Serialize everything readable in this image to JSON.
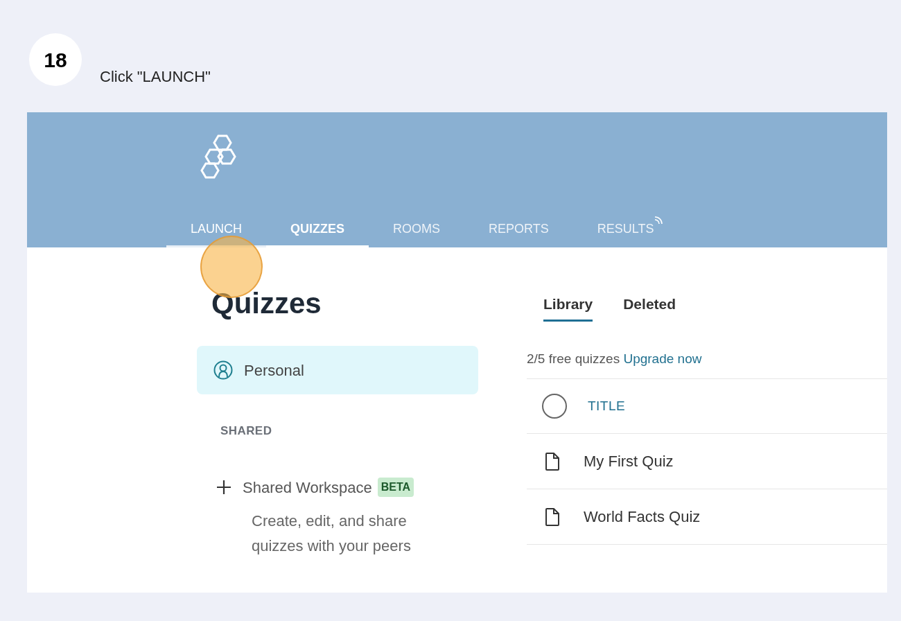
{
  "step": {
    "number": "18",
    "instruction": "Click \"LAUNCH\""
  },
  "nav_tabs": [
    {
      "label": "LAUNCH",
      "selected": false,
      "hovered": true,
      "kind": "plain"
    },
    {
      "label": "QUIZZES",
      "selected": true,
      "hovered": false,
      "kind": "plain"
    },
    {
      "label": "ROOMS",
      "selected": false,
      "hovered": false,
      "kind": "plain"
    },
    {
      "label": "REPORTS",
      "selected": false,
      "hovered": false,
      "kind": "plain"
    },
    {
      "label": "RESULTS",
      "selected": false,
      "hovered": false,
      "kind": "live"
    }
  ],
  "page_title": "Quizzes",
  "sidebar": {
    "items": [
      {
        "label": "Personal",
        "selected": true
      }
    ],
    "section_heading": "SHARED",
    "shared_workspace": {
      "label": "Shared Workspace",
      "badge": "BETA",
      "description": "Create, edit, and share quizzes with your peers"
    }
  },
  "content_tabs": [
    {
      "label": "Library",
      "selected": true
    },
    {
      "label": "Deleted",
      "selected": false
    }
  ],
  "quota": {
    "text": "2/5 free quizzes",
    "link": "Upgrade now"
  },
  "table": {
    "columns": [
      "TITLE"
    ],
    "select_all_checked": false,
    "rows": [
      {
        "title": "My First Quiz"
      },
      {
        "title": "World Facts Quiz"
      }
    ]
  }
}
